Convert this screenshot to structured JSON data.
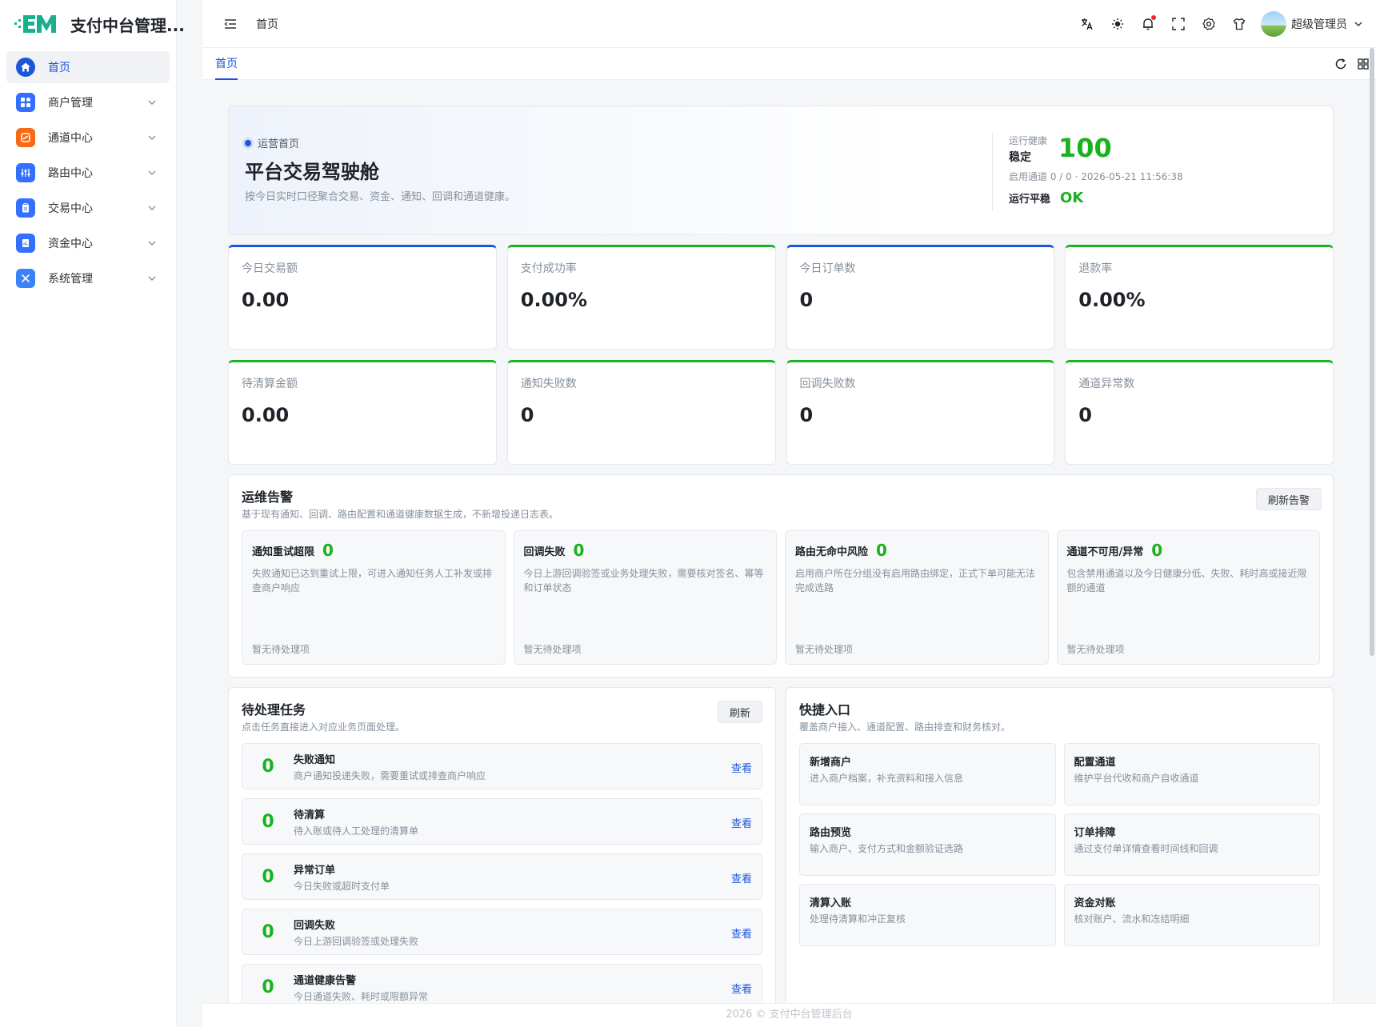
{
  "brand": {
    "title": "支付中台管理...",
    "logo_text": "EM"
  },
  "sidebar": {
    "items": [
      {
        "label": "首页",
        "icon": "home-icon",
        "color": "#1a56db",
        "active": true
      },
      {
        "label": "商户管理",
        "icon": "grid-icon",
        "color": "#3370ff"
      },
      {
        "label": "通道中心",
        "icon": "channel-icon",
        "color": "#f76b15"
      },
      {
        "label": "路由中心",
        "icon": "sliders-icon",
        "color": "#3370ff"
      },
      {
        "label": "交易中心",
        "icon": "clipboard-icon",
        "color": "#3370ff"
      },
      {
        "label": "资金中心",
        "icon": "ledger-icon",
        "color": "#3370ff"
      },
      {
        "label": "系统管理",
        "icon": "tools-icon",
        "color": "#3370ff"
      }
    ]
  },
  "header": {
    "breadcrumb": "首页",
    "icons": [
      "translate-icon",
      "theme-sun-icon",
      "bell-icon",
      "fullscreen-icon",
      "settings-icon",
      "shirt-icon"
    ],
    "user_name": "超级管理员"
  },
  "tabs": {
    "active": "首页"
  },
  "hero": {
    "tag": "运营首页",
    "title": "平台交易驾驶舱",
    "desc": "按今日实时口径聚合交易、资金、通知、回调和通道健康。",
    "health_label": "运行健康",
    "health_state": "稳定",
    "health_score": "100",
    "meta": "启用通道 0 / 0 · 2026-05-21 11:56:38",
    "ok_label": "运行平稳",
    "ok_value": "OK"
  },
  "stats": [
    {
      "label": "今日交易额",
      "value": "0.00",
      "accent": "blue"
    },
    {
      "label": "支付成功率",
      "value": "0.00%",
      "accent": "green"
    },
    {
      "label": "今日订单数",
      "value": "0",
      "accent": "blue"
    },
    {
      "label": "退款率",
      "value": "0.00%",
      "accent": "green"
    },
    {
      "label": "待清算金额",
      "value": "0.00",
      "accent": "green"
    },
    {
      "label": "通知失败数",
      "value": "0",
      "accent": "green"
    },
    {
      "label": "回调失败数",
      "value": "0",
      "accent": "green"
    },
    {
      "label": "通道异常数",
      "value": "0",
      "accent": "green"
    }
  ],
  "alerts": {
    "title": "运维告警",
    "sub": "基于现有通知、回调、路由配置和通道健康数据生成，不新增投递日志表。",
    "refresh_label": "刷新告警",
    "cards": [
      {
        "title": "通知重试超限",
        "count": "0",
        "desc": "失败通知已达到重试上限，可进入通知任务人工补发或排查商户响应",
        "foot": "暂无待处理项"
      },
      {
        "title": "回调失败",
        "count": "0",
        "desc": "今日上游回调验签或业务处理失败，需要核对签名、幂等和订单状态",
        "foot": "暂无待处理项"
      },
      {
        "title": "路由无命中风险",
        "count": "0",
        "desc": "启用商户所在分组没有启用路由绑定，正式下单可能无法完成选路",
        "foot": "暂无待处理项"
      },
      {
        "title": "通道不可用/异常",
        "count": "0",
        "desc": "包含禁用通道以及今日健康分低、失败、耗时高或接近限额的通道",
        "foot": "暂无待处理项"
      }
    ]
  },
  "tasks": {
    "title": "待处理任务",
    "sub": "点击任务直接进入对应业务页面处理。",
    "refresh_label": "刷新",
    "link_label": "查看",
    "items": [
      {
        "count": "0",
        "title": "失败通知",
        "desc": "商户通知投递失败，需要重试或排查商户响应"
      },
      {
        "count": "0",
        "title": "待清算",
        "desc": "待入账或待人工处理的清算单"
      },
      {
        "count": "0",
        "title": "异常订单",
        "desc": "今日失败或超时支付单"
      },
      {
        "count": "0",
        "title": "回调失败",
        "desc": "今日上游回调验签或处理失败"
      },
      {
        "count": "0",
        "title": "通道健康告警",
        "desc": "今日通道失败、耗时或限额异常"
      }
    ]
  },
  "quick": {
    "title": "快捷入口",
    "sub": "覆盖商户接入、通道配置、路由排查和财务核对。",
    "items": [
      {
        "title": "新增商户",
        "desc": "进入商户档案，补充资料和接入信息"
      },
      {
        "title": "配置通道",
        "desc": "维护平台代收和商户自收通道"
      },
      {
        "title": "路由预览",
        "desc": "输入商户、支付方式和金额验证选路"
      },
      {
        "title": "订单排障",
        "desc": "通过支付单详情查看时间线和回调"
      },
      {
        "title": "清算入账",
        "desc": "处理待清算和冲正复核"
      },
      {
        "title": "资金对账",
        "desc": "核对账户、流水和冻结明细"
      }
    ]
  },
  "footer": {
    "text": "2026 © 支付中台管理后台"
  },
  "colors": {
    "primary": "#1a56db",
    "success": "#19b21e",
    "muted": "#86909c"
  }
}
